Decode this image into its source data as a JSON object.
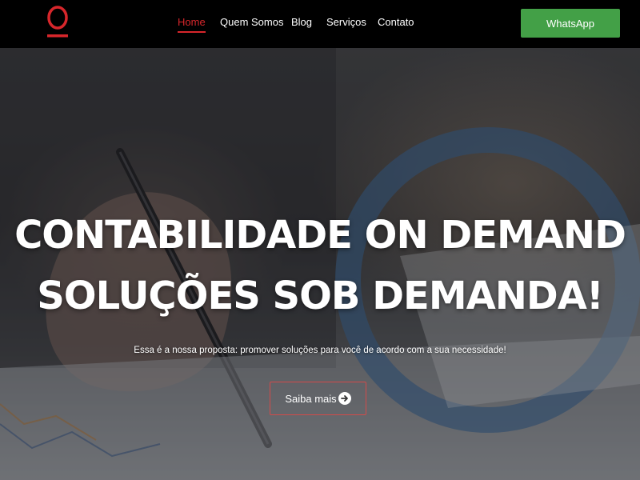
{
  "nav": {
    "logo_alt": "O",
    "items": [
      {
        "label": "Home",
        "active": true
      },
      {
        "label": "Quem Somos",
        "active": false
      },
      {
        "label": "Blog",
        "active": false
      },
      {
        "label": "Serviços",
        "active": false
      },
      {
        "label": "Contato",
        "active": false
      }
    ],
    "whatsapp_label": "WhatsApp"
  },
  "hero": {
    "headline_line1": "CONTABILIDADE ON DEMAND",
    "headline_line2": "SOLUÇÕES SOB DEMANDA!",
    "subtitle": "Essa é a nossa proposta: promover soluções para você de acordo com a sua necessidade!",
    "cta_label": "Saiba mais",
    "cta_icon": "arrow-right-circle-icon"
  },
  "colors": {
    "brand_red": "#d7262b",
    "whatsapp_green": "#43a047",
    "nav_background": "#000000",
    "accent_blue": "#3d6a99"
  }
}
